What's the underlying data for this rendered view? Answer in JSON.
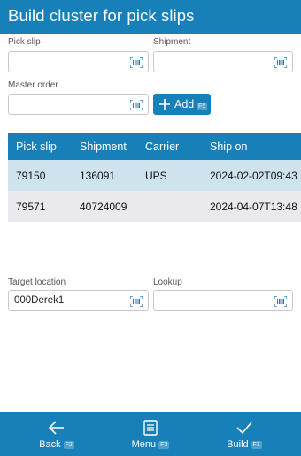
{
  "header": {
    "title": "Build cluster for pick slips"
  },
  "form": {
    "pick_slip": {
      "label": "Pick slip",
      "value": ""
    },
    "shipment": {
      "label": "Shipment",
      "value": ""
    },
    "master_order": {
      "label": "Master order",
      "value": ""
    },
    "add_button": {
      "label": "Add",
      "key": "F5"
    }
  },
  "table": {
    "columns": [
      "Pick slip",
      "Shipment",
      "Carrier",
      "Ship on"
    ],
    "rows": [
      {
        "pick_slip": "79150",
        "shipment": "136091",
        "carrier": "UPS",
        "ship_on": "2024-02-02T09:43"
      },
      {
        "pick_slip": "79571",
        "shipment": "40724009",
        "carrier": "",
        "ship_on": "2024-04-07T13:48"
      }
    ]
  },
  "bottom_form": {
    "target_location": {
      "label": "Target location",
      "value": "000Derek1"
    },
    "lookup": {
      "label": "Lookup",
      "value": ""
    }
  },
  "footer": {
    "back": {
      "label": "Back",
      "key": "F2"
    },
    "menu": {
      "label": "Menu",
      "key": "F3"
    },
    "build": {
      "label": "Build",
      "key": "F1"
    }
  },
  "colors": {
    "accent": "#1780b8",
    "selected_row": "#cfe3ef",
    "row_alt": "#eaeaee"
  },
  "icons": [
    "barcode-scan-icon",
    "plus-icon",
    "arrow-left-icon",
    "menu-icon",
    "checkmark-icon"
  ]
}
